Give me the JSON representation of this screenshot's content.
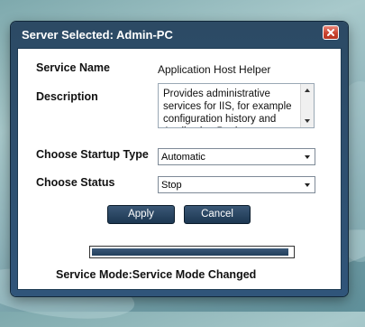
{
  "dialog": {
    "title": "Server Selected: Admin-PC"
  },
  "service": {
    "name_label": "Service Name",
    "name_value": "Application Host Helper",
    "description_label": "Description",
    "description_value": "Provides administrative services for IIS, for example configuration history and Application Pool account"
  },
  "startup": {
    "label": "Choose Startup Type",
    "selected": "Automatic"
  },
  "status_select": {
    "label": "Choose Status",
    "selected": "Stop"
  },
  "buttons": {
    "apply": "Apply",
    "cancel": "Cancel"
  },
  "progress": {
    "fraction": 0.98
  },
  "status_message": "Service Mode:Service Mode Changed",
  "icons": [
    "close-icon",
    "scroll-up-icon",
    "scroll-down-icon",
    "dropdown-arrow-icon"
  ]
}
